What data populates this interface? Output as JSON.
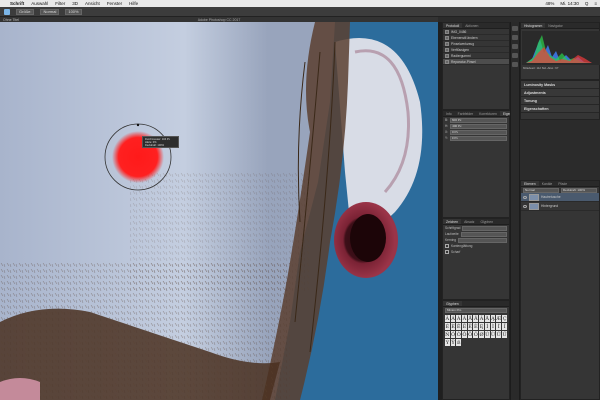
{
  "menubar": {
    "items": [
      "Schrift",
      "Auswahl",
      "Filter",
      "3D",
      "Ansicht",
      "Fenster",
      "Hilfe"
    ],
    "right": [
      "48%",
      "Mi. 14:30",
      "Q",
      "≡"
    ]
  },
  "options": {
    "brush_size": "Größe:",
    "mode": "Normal",
    "flow": "100%"
  },
  "window": {
    "title": "Adobe Photoshop CC 2017",
    "doc_tab": "Ohne Titel"
  },
  "tooltip": {
    "lines": [
      "Durchmesser: 104 Px",
      "Härte: 0%",
      "Deckkraft: 100%"
    ]
  },
  "history": {
    "tabs": [
      "Protokoll",
      "Aktionen"
    ],
    "items": [
      "IMG_0486",
      "Ebenenstil ändern",
      "Pinselwerkzeug",
      "Verflüssigen",
      "Radiergummi",
      "Reparatur-Pinsel"
    ]
  },
  "histogram": {
    "tabs": [
      "Histogramm",
      "Navigator"
    ],
    "caption": "Mittelwert: 112   Std.-Abw.: 67"
  },
  "sections": [
    "Luminosity Masks",
    "Adjustments",
    "Tonung",
    "Eigenschaften"
  ],
  "properties": {
    "tabs": [
      "Info",
      "Farbfelder",
      "Korrekturen",
      "Eigenschaften"
    ],
    "labels": [
      "B:",
      "H:",
      "X:",
      "Y:"
    ],
    "values": [
      "600 Px",
      "400 Px",
      "0 Px",
      "0 Px"
    ]
  },
  "character": {
    "tabs": [
      "Zeichen",
      "Absatz",
      "Glyphen"
    ],
    "labels": [
      "Schriftgrad",
      "Laufweite",
      "Kerning"
    ],
    "check_labels": [
      "Kantenglättung",
      "Scharf"
    ]
  },
  "glyphs": {
    "title": "Glyphen",
    "font": "Minion Pro",
    "chars": [
      "Ä",
      "Á",
      "À",
      "Â",
      "Å",
      "Ã",
      "Ā",
      "Ă",
      "Ą",
      "Æ",
      "Ç",
      "É",
      "È",
      "Ê",
      "Ë",
      "Ē",
      "Ė",
      "Ę",
      "Í",
      "Ì",
      "Î",
      "Ï",
      "Ñ",
      "Ó",
      "Ò",
      "Ô",
      "Ö",
      "Õ",
      "Ø",
      "Ú",
      "Ù",
      "Û",
      "Ü",
      "Ý",
      "Ÿ",
      "ß"
    ]
  },
  "layers": {
    "tabs": [
      "Ebenen",
      "Kanäle",
      "Pfade"
    ],
    "mode": "Normal",
    "opacity": "Deckkraft: 100%",
    "items": [
      "Hautretusche",
      "Hintergrund"
    ]
  }
}
